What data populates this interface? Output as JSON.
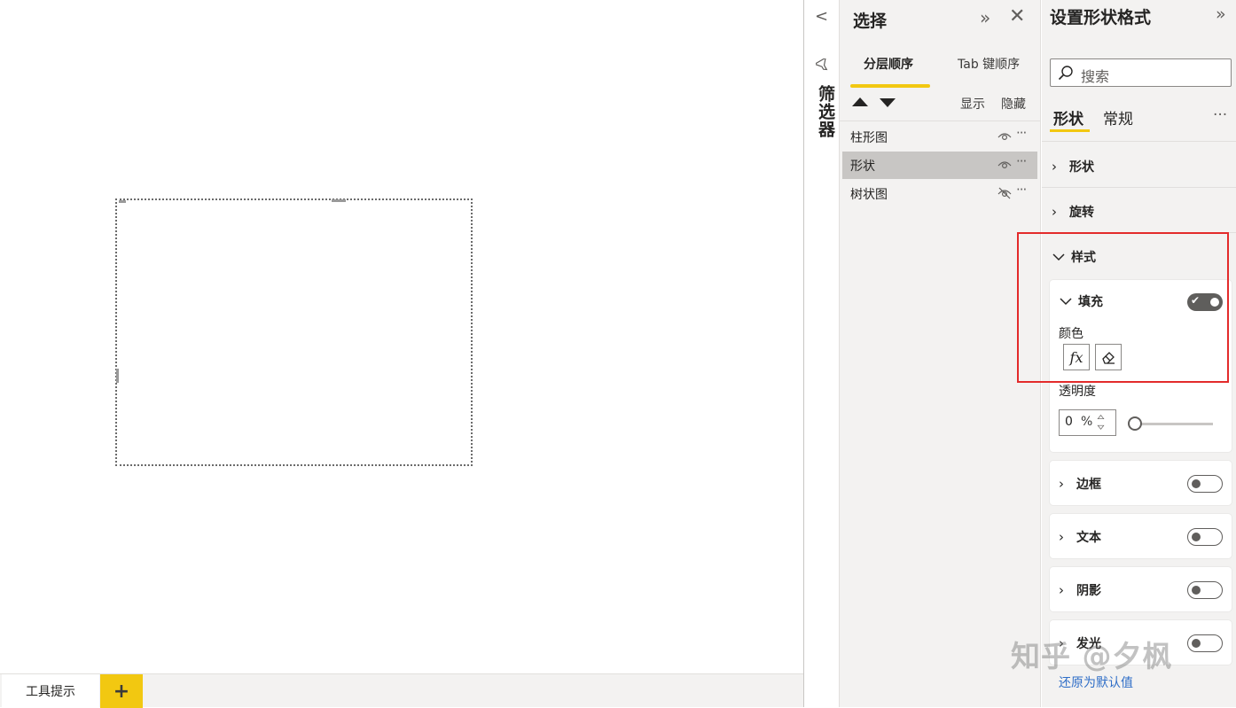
{
  "canvas": {
    "page_tab": "工具提示",
    "add_page": "+"
  },
  "filters": {
    "collapse": "<",
    "label": "筛选器"
  },
  "selection": {
    "title": "选择",
    "expand": "»",
    "close": "✕",
    "tabs": [
      "分层顺序",
      "Tab 键顺序"
    ],
    "show_label": "显示",
    "hide_label": "隐藏",
    "layers": [
      {
        "name": "柱形图",
        "visible": true,
        "more": "···"
      },
      {
        "name": "形状",
        "visible": true,
        "more": "···",
        "selected": true
      },
      {
        "name": "树状图",
        "visible": false,
        "more": "···"
      }
    ]
  },
  "format": {
    "title": "设置形状格式",
    "expand": "»",
    "search_placeholder": "搜索",
    "tabs": [
      "形状",
      "常规"
    ],
    "more": "···",
    "sections": [
      "形状",
      "旋转",
      "样式"
    ],
    "fill": {
      "label": "填充",
      "color_label": "颜色",
      "fx_label": "fx",
      "transparency_label": "透明度",
      "transparency_value": "0",
      "transparency_unit": "%",
      "transparency_slider": 0
    },
    "cards": [
      {
        "label": "边框",
        "on": false
      },
      {
        "label": "文本",
        "on": false
      },
      {
        "label": "阴影",
        "on": false
      },
      {
        "label": "发光",
        "on": false
      }
    ],
    "reset": "还原为默认值",
    "toggle_check": "✔"
  },
  "watermark": "知乎 @夕枫",
  "colors": {
    "accent": "#f2c811",
    "highlight": "#e32b2b",
    "link": "#2f6ec7"
  }
}
